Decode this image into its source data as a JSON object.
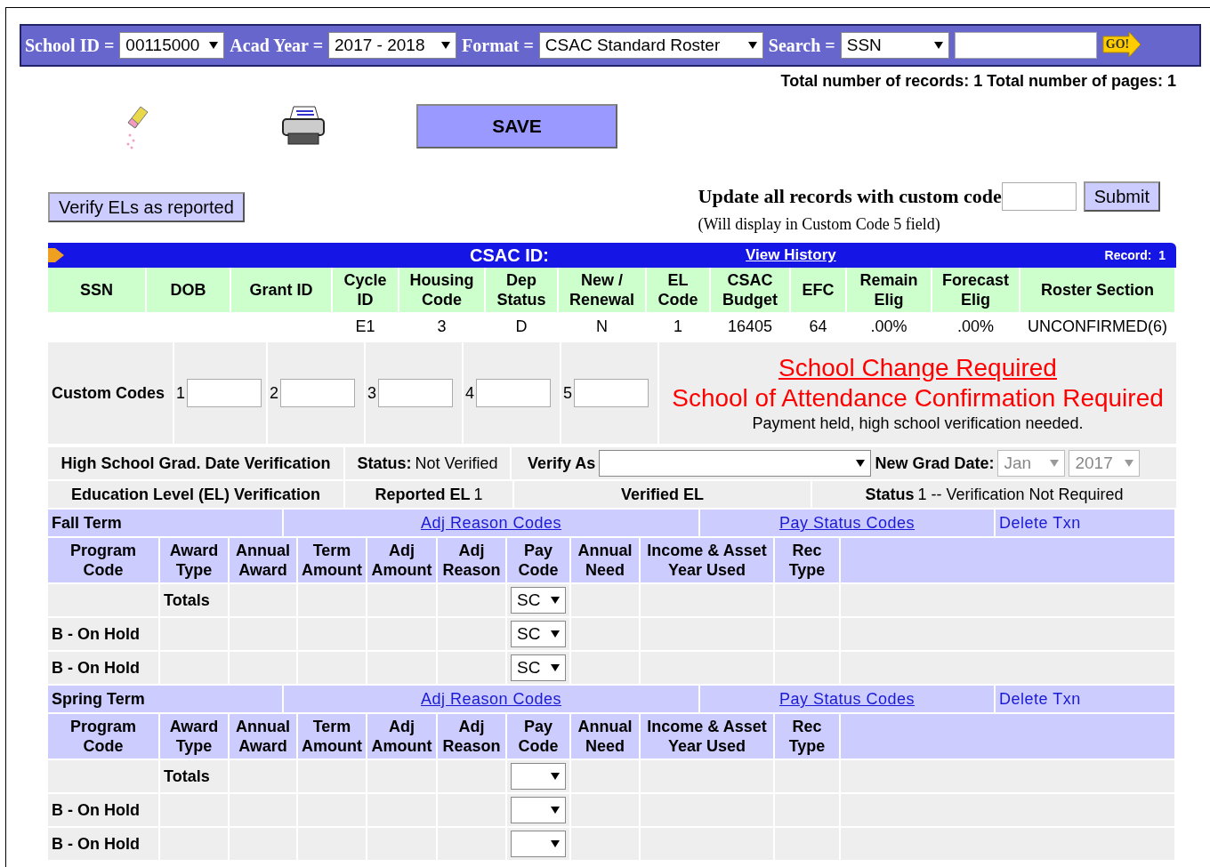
{
  "toolbar": {
    "fields": [
      {
        "label": "School ID =",
        "value": "00115000"
      },
      {
        "label": "Acad Year =",
        "value": "2017 - 2018"
      },
      {
        "label": "Format =",
        "value": "CSAC Standard Roster"
      },
      {
        "label": "Search =",
        "value": "SSN"
      }
    ],
    "go": "GO!"
  },
  "totals_line": "Total number of records: 1 Total number of pages: 1",
  "save": "SAVE",
  "verify_button": "Verify ELs as reported",
  "custom_update": {
    "label": "Update all records with custom code",
    "submit": "Submit",
    "note": "(Will display in Custom Code 5 field)"
  },
  "record_bar": {
    "title": "CSAC ID:",
    "link": "View History",
    "record": "Record:  1"
  },
  "summary": {
    "columns": [
      "SSN",
      "DOB",
      "Grant ID",
      "Cycle ID",
      "Housing Code",
      "Dep Status",
      "New / Renewal",
      "EL Code",
      "CSAC Budget",
      "EFC",
      "Remain Elig",
      "Forecast Elig",
      "Roster Section"
    ],
    "row": [
      "E1",
      "3",
      "D",
      "N",
      "1",
      "16405",
      "64",
      ".00%",
      ".00%",
      "UNCONFIRMED(6)"
    ]
  },
  "custom_codes": {
    "label": "Custom Codes",
    "slots": [
      "1",
      "2",
      "3",
      "4",
      "5"
    ]
  },
  "alerts": {
    "link": "School Change Required",
    "title": "School of Attendance Confirmation Required",
    "note": "Payment held, high school verification needed."
  },
  "grad_verification": {
    "label": "High School Grad. Date Verification",
    "status_label": "Status:",
    "status": "Not Verified",
    "verify_label": "Verify As",
    "new_grad_label": "New Grad Date:",
    "month": "Jan",
    "year": "2017",
    "disabled": true
  },
  "el_verification": {
    "label": "Education Level (EL) Verification",
    "reported_label": "Reported EL",
    "reported": "1",
    "verified_label": "Verified EL",
    "status_label": "Status",
    "status": "1 -- Verification Not Required"
  },
  "terms": [
    {
      "name": "Fall Term",
      "links": [
        "Adj Reason Codes",
        "Pay Status Codes"
      ],
      "delete": "Delete Txn",
      "columns": [
        "Program Code",
        "Award Type",
        "Annual Award",
        "Term Amount",
        "Adj Amount",
        "Adj Reason",
        "Pay Code",
        "Annual Need",
        "Income & Asset Year Used",
        "Rec Type"
      ],
      "rows": [
        {
          "program": "",
          "award": "Totals",
          "pay_code": "SC"
        },
        {
          "program": "B - On Hold",
          "award": "",
          "pay_code": "SC"
        },
        {
          "program": "B - On Hold",
          "award": "",
          "pay_code": "SC"
        }
      ]
    },
    {
      "name": "Spring Term",
      "links": [
        "Adj Reason Codes",
        "Pay Status Codes"
      ],
      "delete": "Delete Txn",
      "columns": [
        "Program Code",
        "Award Type",
        "Annual Award",
        "Term Amount",
        "Adj Amount",
        "Adj Reason",
        "Pay Code",
        "Annual Need",
        "Income & Asset Year Used",
        "Rec Type"
      ],
      "rows": [
        {
          "program": "",
          "award": "Totals",
          "pay_code": ""
        },
        {
          "program": "B - On Hold",
          "award": "",
          "pay_code": ""
        },
        {
          "program": "B - On Hold",
          "award": "",
          "pay_code": ""
        }
      ]
    }
  ]
}
